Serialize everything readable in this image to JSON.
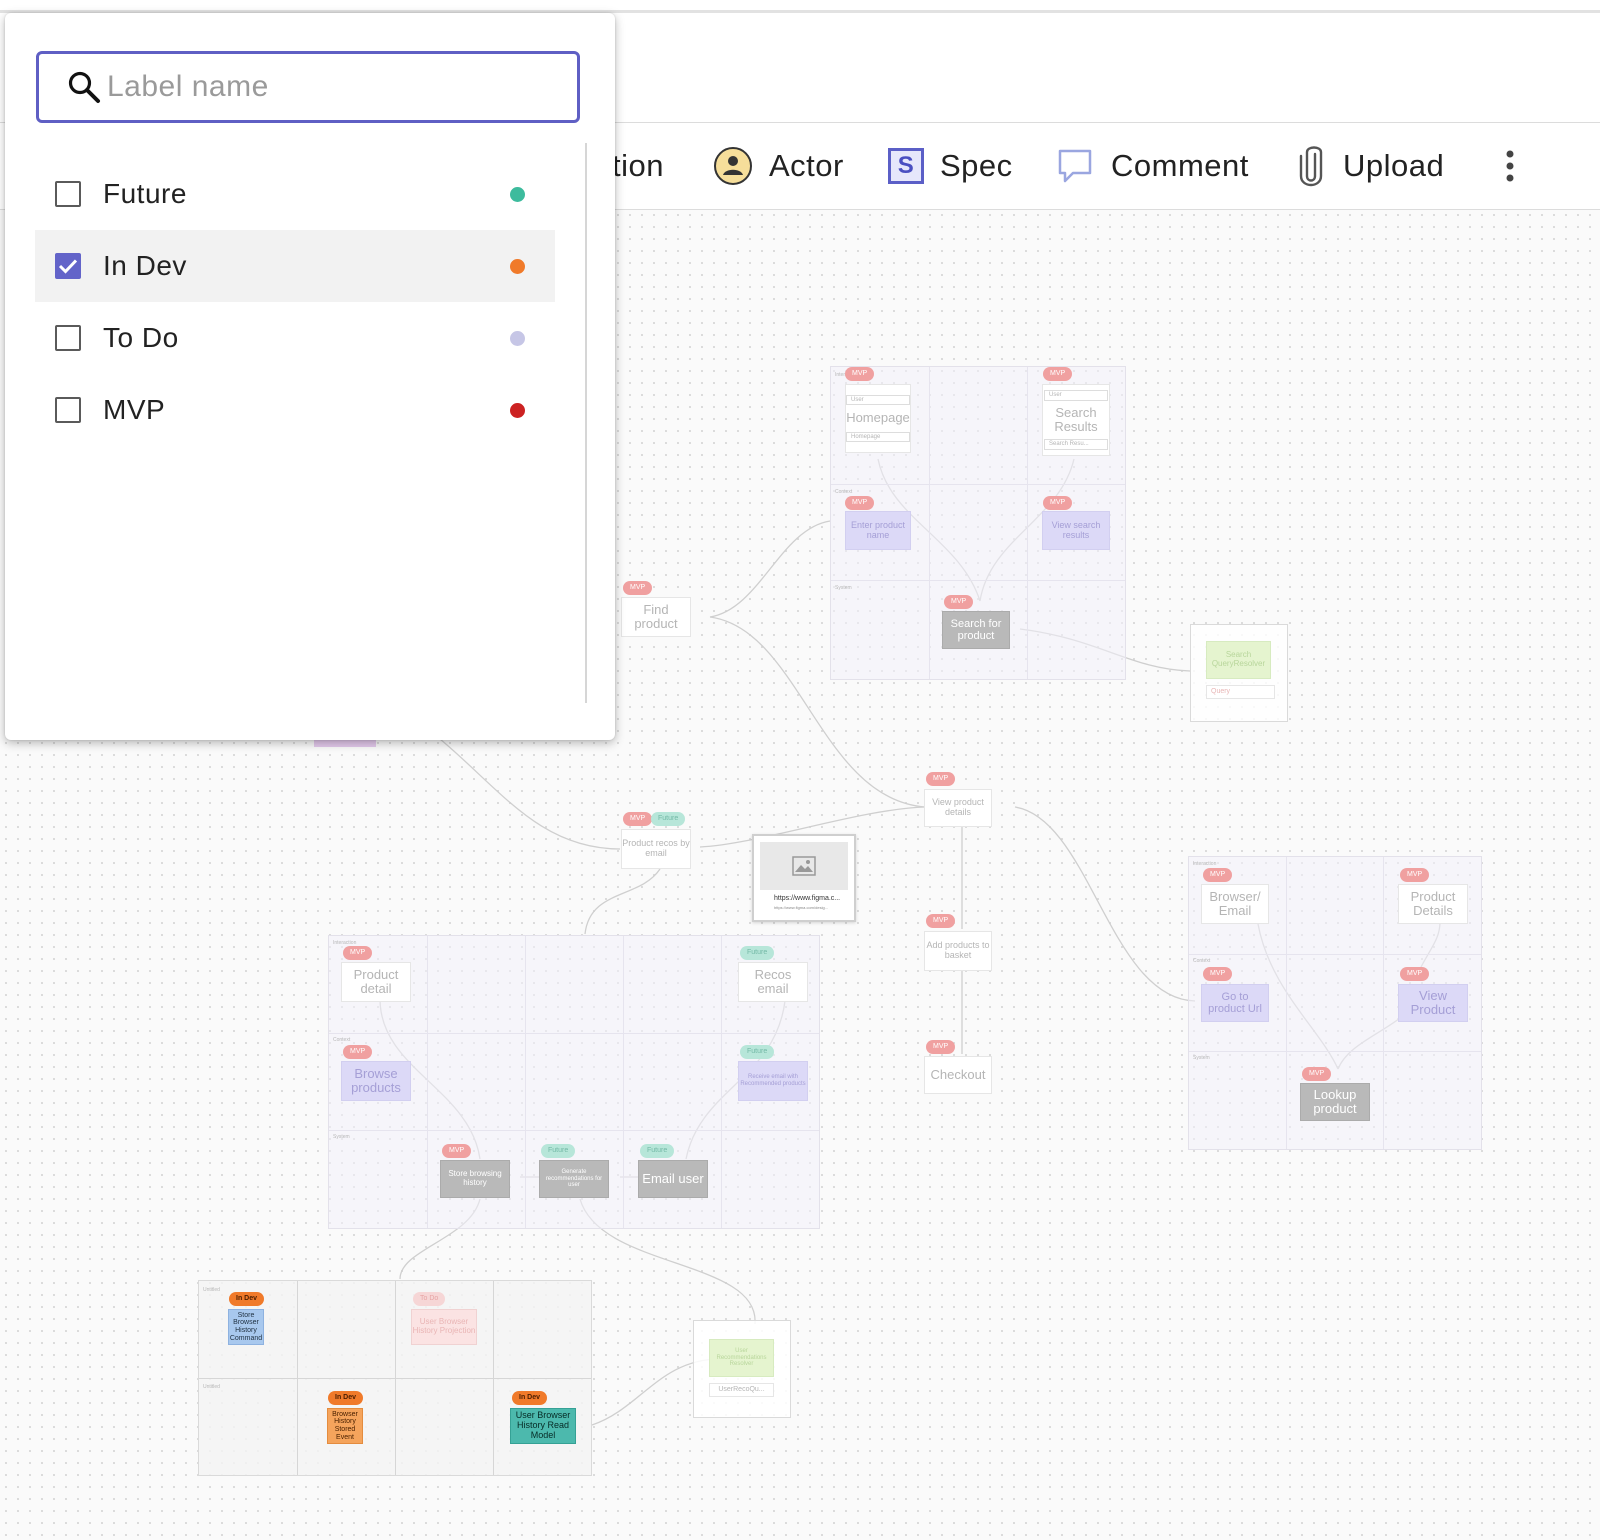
{
  "search": {
    "placeholder": "Label name"
  },
  "labels": [
    {
      "name": "Future",
      "color": "#3dbb9d",
      "checked": false
    },
    {
      "name": "In Dev",
      "color": "#f07a2a",
      "checked": true
    },
    {
      "name": "To Do",
      "color": "#c6c6e6",
      "checked": false
    },
    {
      "name": "MVP",
      "color": "#cc2222",
      "checked": false
    }
  ],
  "toolbar": {
    "partial_label": "tion",
    "actor_label": "Actor",
    "spec_label": "Spec",
    "spec_icon_letter": "S",
    "comment_label": "Comment",
    "upload_label": "Upload"
  },
  "board": {
    "tags": {
      "mvp": "MVP",
      "future": "Future",
      "todo": "To Do",
      "indev": "In Dev"
    },
    "frame_labels": {
      "interaction": "Interaction",
      "context": "Context",
      "system": "System",
      "untitled": "Untitled"
    },
    "cards": {
      "find_product": "Find product",
      "homepage": "Homepage",
      "search_results": "Search Results",
      "enter_product_name": "Enter product name",
      "view_search_results": "View search results",
      "search_for_product": "Search for product",
      "search_query_resolver": "Search QueryResolver",
      "query": "Query",
      "user": "User",
      "homepage_ref": "Homepage",
      "search_results_ref": "Search Resu...",
      "view_product_details": "View product details",
      "product_recos_by_email": "Product recos by email",
      "add_products_to_basket": "Add products to basket",
      "checkout": "Checkout",
      "browser_email": "Browser/ Email",
      "product_details": "Product Details",
      "go_to_product_url": "Go to product Url",
      "view_product": "View Product",
      "lookup_product": "Lookup product",
      "product_detail": "Product detail",
      "recos_email": "Recos email",
      "browse_products": "Browse products",
      "receive_email": "Receive email with Recommended products",
      "store_browsing_history": "Store browsing history",
      "generate_recommendations": "Generate recommendations for user",
      "email_user": "Email user",
      "store_browser_history_command": "Store Browser History Command",
      "user_browser_history_projection": "User Browser History Projection",
      "browser_history_stored_event": "Browser History Stored Event",
      "user_browser_history_read_model": "User Browser History Read Model",
      "user_recommendations_resolver": "User Recommendations Resolver",
      "user_reco_query": "UserRecoQu...",
      "link_title": "https://www.figma.c...",
      "link_url": "https://www.figma.com/desig..."
    }
  }
}
